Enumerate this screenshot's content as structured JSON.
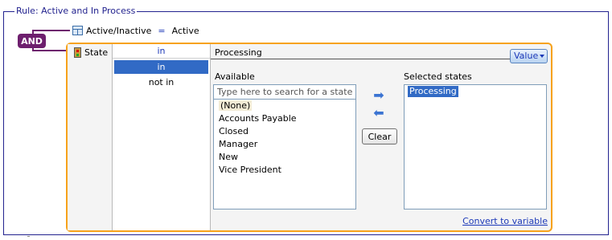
{
  "rule": {
    "title": "Rule: Active and In Process"
  },
  "logic": {
    "operator": "AND"
  },
  "condition1": {
    "field": "Active/Inactive",
    "operator": "=",
    "value": "Active",
    "icon": "table-field-icon"
  },
  "condition2": {
    "field": "State",
    "icon": "state-field-icon",
    "operator_header": "in",
    "operators": [
      "in",
      "not in"
    ],
    "selected_operator": "in",
    "value_header": "Processing",
    "value_type_label": "Value",
    "available_label": "Available",
    "selected_label": "Selected states",
    "search_placeholder": "Type here to search for a state...",
    "available_items": [
      "(None)",
      "Accounts Payable",
      "Closed",
      "Manager",
      "New",
      "Vice President"
    ],
    "selected_items": [
      "Processing"
    ],
    "add_icon": "arrow-right-icon",
    "remove_icon": "arrow-left-icon",
    "clear_label": "Clear",
    "convert_link": "Convert to variable"
  },
  "colors": {
    "accent_orange": "#f7a21a",
    "and_purple": "#6e1f6e",
    "rule_border": "#23238f",
    "selection_blue": "#316ac5",
    "link_blue": "#1b38b8"
  }
}
